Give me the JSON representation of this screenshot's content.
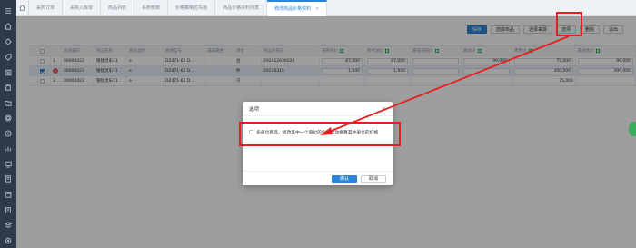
{
  "tabs": [
    {
      "label": "采购订单",
      "active": false
    },
    {
      "label": "采购入库单",
      "active": false
    },
    {
      "label": "商品列表",
      "active": false
    },
    {
      "label": "系统参数",
      "active": false
    },
    {
      "label": "价格策略优先级",
      "active": false
    },
    {
      "label": "商品价格资料列表",
      "active": false
    },
    {
      "label": "修改商品价格资料",
      "active": true
    }
  ],
  "toolbar": {
    "save": "保存",
    "select_goods": "选择商品",
    "select_tpl": "选择来源",
    "options": "选项",
    "delete": "删除",
    "exit": "退出"
  },
  "table": {
    "headers": [
      "",
      "",
      "",
      "商品编码",
      "商品名称",
      "商品类别",
      "规格型号",
      "辅助属性",
      "单位",
      "商品条形码",
      "采购单价",
      "参考进价",
      "最低采购价",
      "最高价",
      "零售价",
      "最低售价"
    ],
    "rows": [
      {
        "idx": "1",
        "code": "00000023",
        "name": "铭钛灵乐11",
        "cat": "e",
        "spec": "DZ471-62 D...",
        "attr": "",
        "unit": "台",
        "barcode": "202012030020",
        "p1": "87,000",
        "p2": "87,000",
        "p3": "",
        "p4": "99,000",
        "p5": "75,000",
        "p6": "99,000",
        "selected": false
      },
      {
        "idx": "2",
        "code": "00000023",
        "name": "铭钛灵乐11",
        "cat": "e",
        "spec": "DZ471-62 D...",
        "attr": "",
        "unit": "件",
        "barcode": "20210315",
        "p1": "1,940",
        "p2": "1,940",
        "p3": "",
        "p4": "",
        "p5": "300,000",
        "p6": "399,000",
        "selected": true
      },
      {
        "idx": "3",
        "code": "00000023",
        "name": "铭钛灵乐11",
        "cat": "e",
        "spec": "DZ471-62 D...",
        "attr": "",
        "unit": "只",
        "barcode": "",
        "p1": "",
        "p2": "",
        "p3": "",
        "p4": "",
        "p5": "75,000",
        "p6": "",
        "selected": false
      }
    ]
  },
  "dialog": {
    "title": "选项",
    "close": "×",
    "option_text": "多单位商品，修改其中一个单位的价格自动换算其他单位的价格",
    "ok": "确认",
    "cancel": "取消"
  },
  "colors": {
    "accent": "#2a85d9",
    "annotation": "#e61e1e",
    "sidebar": "#2e3a48"
  }
}
